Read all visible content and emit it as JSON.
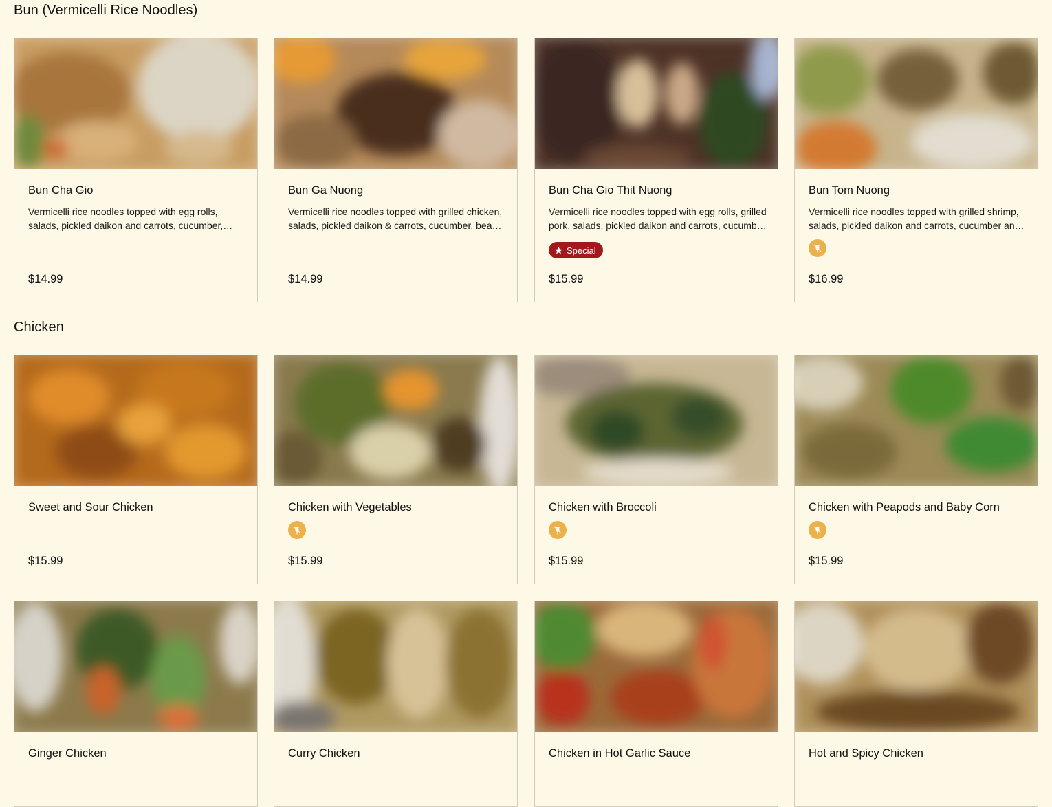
{
  "sections": [
    {
      "title": "Bun (Vermicelli Rice Noodles)",
      "items": [
        {
          "name": "Bun Cha Gio",
          "description": "Vermicelli rice noodles topped with egg rolls, salads, pickled daikon and carrots, cucumber, bean sprouts and peanuts.",
          "price": "$14.99"
        },
        {
          "name": "Bun Ga Nuong",
          "description": "Vermicelli rice noodles topped with grilled chicken, salads, pickled daikon & carrots, cucumber, bean sprouts and peanuts.",
          "price": "$14.99"
        },
        {
          "name": "Bun Cha Gio Thit Nuong",
          "description": "Vermicelli rice noodles topped with egg rolls, grilled pork, salads, pickled daikon and carrots, cucumber and peanuts.",
          "badge": "Special",
          "price": "$15.99"
        },
        {
          "name": "Bun Tom Nuong",
          "description": "Vermicelli rice noodles topped with grilled shrimp, salads, pickled daikon and carrots, cucumber and peanuts.",
          "gluten_free_icon": "gluten-free-icon",
          "price": "$16.99"
        }
      ]
    },
    {
      "title": "Chicken",
      "items": [
        {
          "name": "Sweet and Sour Chicken",
          "price": "$15.99"
        },
        {
          "name": "Chicken with Vegetables",
          "gluten_free_icon": "gluten-free-icon",
          "price": "$15.99"
        },
        {
          "name": "Chicken with Broccoli",
          "gluten_free_icon": "gluten-free-icon",
          "price": "$15.99"
        },
        {
          "name": "Chicken with Peapods and Baby Corn",
          "gluten_free_icon": "gluten-free-icon",
          "price": "$15.99"
        },
        {
          "name": "Ginger Chicken"
        },
        {
          "name": "Curry Chicken"
        },
        {
          "name": "Chicken in Hot Garlic Sauce"
        },
        {
          "name": "Hot and Spicy Chicken"
        }
      ]
    }
  ],
  "colors": {
    "background": "#fef8e6",
    "card_border": "#d3cdbd",
    "special_badge": "#a3181c",
    "gluten_free_icon": "#ebb14c"
  }
}
